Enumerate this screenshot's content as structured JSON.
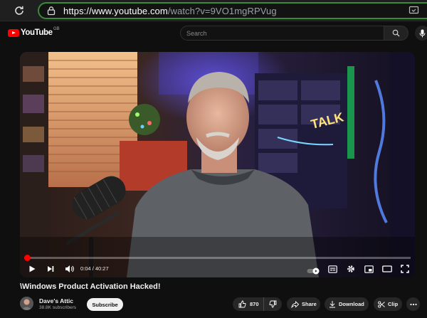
{
  "browser": {
    "url_host": "https://www.youtube.com",
    "url_rest": "/watch?v=9VO1mgRPVug"
  },
  "masthead": {
    "logo_text": "YouTube",
    "region_code": "GB",
    "search_placeholder": "Search"
  },
  "player": {
    "current_time": "0:04",
    "duration": "40:27",
    "time_separator": " / ",
    "progress": 0.0016,
    "scene_sign_text": "TALK"
  },
  "video": {
    "title": "\\Windows Product Activation Hacked!",
    "channel_name": "Dave's Attic",
    "subscribers": "38.8K subscribers",
    "subscribe_label": "Subscribe",
    "like_count": "870",
    "share_label": "Share",
    "download_label": "Download",
    "clip_label": "Clip"
  },
  "colors": {
    "accent": "#ff0000",
    "url_border": "#3a8a3a",
    "background": "#0f0f0f"
  }
}
